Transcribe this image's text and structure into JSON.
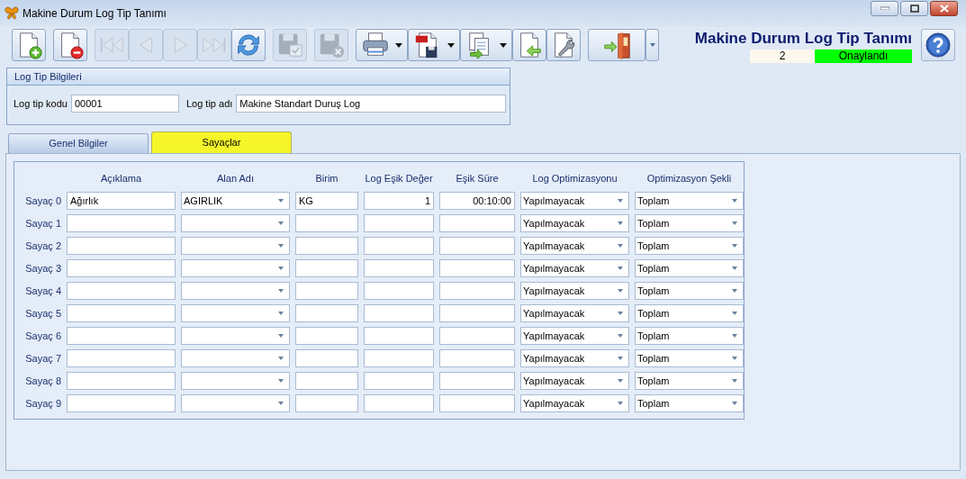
{
  "window": {
    "title": "Makine Durum Log Tip Tanımı"
  },
  "toolbar": [
    [
      {
        "kind": "new",
        "disabled": false
      }
    ],
    [
      {
        "kind": "delete",
        "disabled": false
      }
    ],
    [
      {
        "kind": "first",
        "disabled": true
      },
      {
        "kind": "prev",
        "disabled": true
      },
      {
        "kind": "next",
        "disabled": true
      },
      {
        "kind": "last",
        "disabled": true
      },
      {
        "kind": "refresh",
        "disabled": false
      }
    ],
    [
      {
        "kind": "save",
        "disabled": true
      }
    ],
    [
      {
        "kind": "cancel",
        "disabled": true
      }
    ],
    [
      {
        "kind": "print",
        "disabled": false,
        "dropdown": true
      },
      {
        "kind": "pdf",
        "disabled": false,
        "dropdown": true
      },
      {
        "kind": "export",
        "disabled": false,
        "dropdown": true
      },
      {
        "kind": "import",
        "disabled": false
      },
      {
        "kind": "settings",
        "disabled": false
      }
    ],
    [
      {
        "kind": "exit",
        "disabled": false,
        "split": true
      }
    ]
  ],
  "header": {
    "title": "Makine Durum Log Tip Tanımı",
    "record": "2",
    "status": {
      "text": "Onaylandı",
      "color": "#00ff00"
    }
  },
  "log_tip_bilgileri": {
    "title": "Log Tip Bilgileri",
    "fields": [
      {
        "label": "Log tip kodu",
        "value": "00001"
      },
      {
        "label": "Log tip adı",
        "value": "Makine Standart Duruş Log"
      }
    ]
  },
  "tabs": [
    {
      "label": "Genel Bilgiler",
      "selected": false
    },
    {
      "label": "Sayaçlar",
      "selected": true
    }
  ],
  "counters": {
    "columns": [
      "Açıklama",
      "Alan Adı",
      "Birim",
      "Log Eşik Değer",
      "Eşik Süre",
      "Log Optimizasyonu",
      "Optimizasyon Şekli"
    ],
    "rows": [
      {
        "label": "Sayaç 0",
        "aciklama": "Ağırlık",
        "alan_adi": "AGIRLIK",
        "birim": "KG",
        "esik_deger": "1",
        "esik_sure": "00:10:00",
        "log_optimizasyonu": "Yapılmayacak",
        "optimizasyon_sekli": "Toplam"
      },
      {
        "label": "Sayaç 1",
        "log_optimizasyonu": "Yapılmayacak",
        "optimizasyon_sekli": "Toplam"
      },
      {
        "label": "Sayaç 2",
        "log_optimizasyonu": "Yapılmayacak",
        "optimizasyon_sekli": "Toplam"
      },
      {
        "label": "Sayaç 3",
        "log_optimizasyonu": "Yapılmayacak",
        "optimizasyon_sekli": "Toplam"
      },
      {
        "label": "Sayaç 4",
        "log_optimizasyonu": "Yapılmayacak",
        "optimizasyon_sekli": "Toplam"
      },
      {
        "label": "Sayaç 5",
        "log_optimizasyonu": "Yapılmayacak",
        "optimizasyon_sekli": "Toplam"
      },
      {
        "label": "Sayaç 6",
        "log_optimizasyonu": "Yapılmayacak",
        "optimizasyon_sekli": "Toplam"
      },
      {
        "label": "Sayaç 7",
        "log_optimizasyonu": "Yapılmayacak",
        "optimizasyon_sekli": "Toplam"
      },
      {
        "label": "Sayaç 8",
        "log_optimizasyonu": "Yapılmayacak",
        "optimizasyon_sekli": "Toplam"
      },
      {
        "label": "Sayaç 9",
        "log_optimizasyonu": "Yapılmayacak",
        "optimizasyon_sekli": "Toplam"
      }
    ]
  }
}
